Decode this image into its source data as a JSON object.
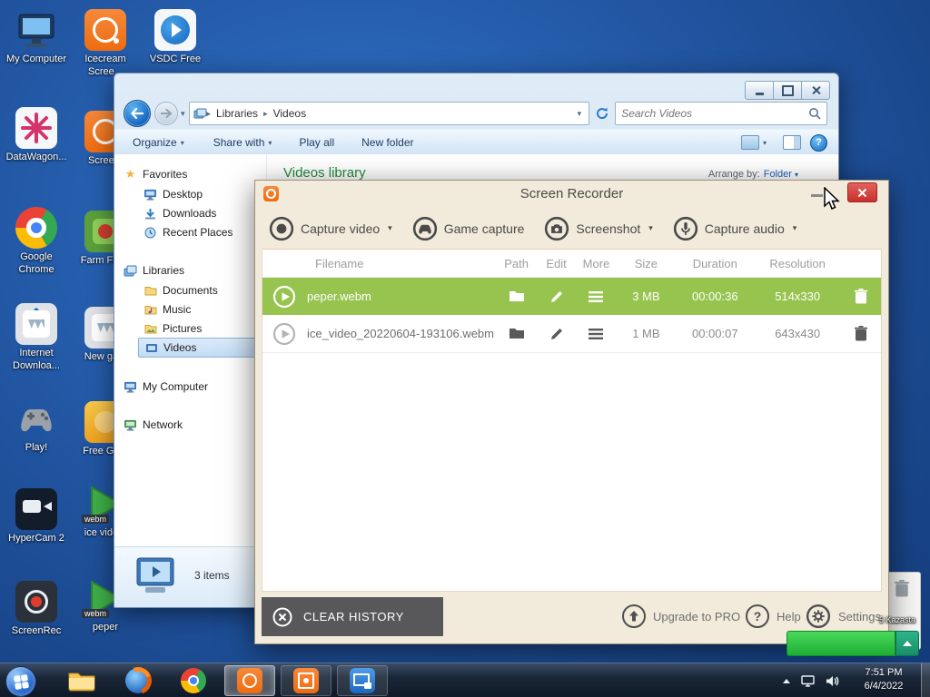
{
  "colors": {
    "accent_orange": "#f47b20",
    "selected_row_green": "#96c44e",
    "close_button_red": "#cf3b2f",
    "library_title_green": "#218a3b",
    "popup_green": "#2fc843"
  },
  "glyphs": {
    "chevron_down": "▾",
    "crumb_sep": "▸",
    "star": "★",
    "help_mark": "?"
  },
  "desktop": {
    "webm_badge": "webm",
    "icons": [
      {
        "label": "My Computer"
      },
      {
        "label": "Icecream Scree..."
      },
      {
        "label": "VSDC Free"
      },
      {
        "label": "DataWagon..."
      },
      {
        "label": "Scree..."
      },
      {
        "label": "Google Chrome"
      },
      {
        "label": "Farm Fre..."
      },
      {
        "label": "Internet Downloa..."
      },
      {
        "label": "New ga..."
      },
      {
        "label": "Play!"
      },
      {
        "label": "Free Ga..."
      },
      {
        "label": "HyperCam 2"
      },
      {
        "label": "ice vide..."
      },
      {
        "label": "ScreenRec"
      },
      {
        "label": "peper"
      }
    ]
  },
  "explorer": {
    "breadcrumb": {
      "items": [
        "Libraries",
        "Videos"
      ]
    },
    "search": {
      "placeholder": "Search Videos"
    },
    "toolbar": {
      "organize": "Organize",
      "share": "Share with",
      "play_all": "Play all",
      "new_folder": "New folder"
    },
    "sidebar": {
      "favorites": "Favorites",
      "favorites_items": [
        "Desktop",
        "Downloads",
        "Recent Places"
      ],
      "libraries": "Libraries",
      "libraries_items": [
        "Documents",
        "Music",
        "Pictures",
        "Videos"
      ],
      "computer": "My Computer",
      "network": "Network"
    },
    "main": {
      "title": "Videos library",
      "arrange_label": "Arrange by:",
      "arrange_value": "Folder"
    },
    "status": {
      "items": "3 items"
    }
  },
  "recorder": {
    "title": "Screen Recorder",
    "actions": {
      "capture_video": "Capture video",
      "game_capture": "Game capture",
      "screenshot": "Screenshot",
      "capture_audio": "Capture audio"
    },
    "table": {
      "headers": [
        "Filename",
        "Path",
        "Edit",
        "More",
        "Size",
        "Duration",
        "Resolution"
      ],
      "rows": [
        {
          "filename": "peper.webm",
          "size": "3 MB",
          "duration": "00:00:36",
          "resolution": "514x330"
        },
        {
          "filename": "ice_video_20220604-193106.webm",
          "size": "1 MB",
          "duration": "00:00:07",
          "resolution": "643x430"
        }
      ]
    },
    "footer": {
      "clear_history": "CLEAR HISTORY",
      "upgrade": "Upgrade to PRO",
      "help": "Help",
      "settings": "Settings"
    }
  },
  "popup": {
    "label": "5 Kazasta"
  },
  "taskbar": {
    "clock": {
      "time": "7:51 PM",
      "date": "6/4/2022"
    }
  }
}
